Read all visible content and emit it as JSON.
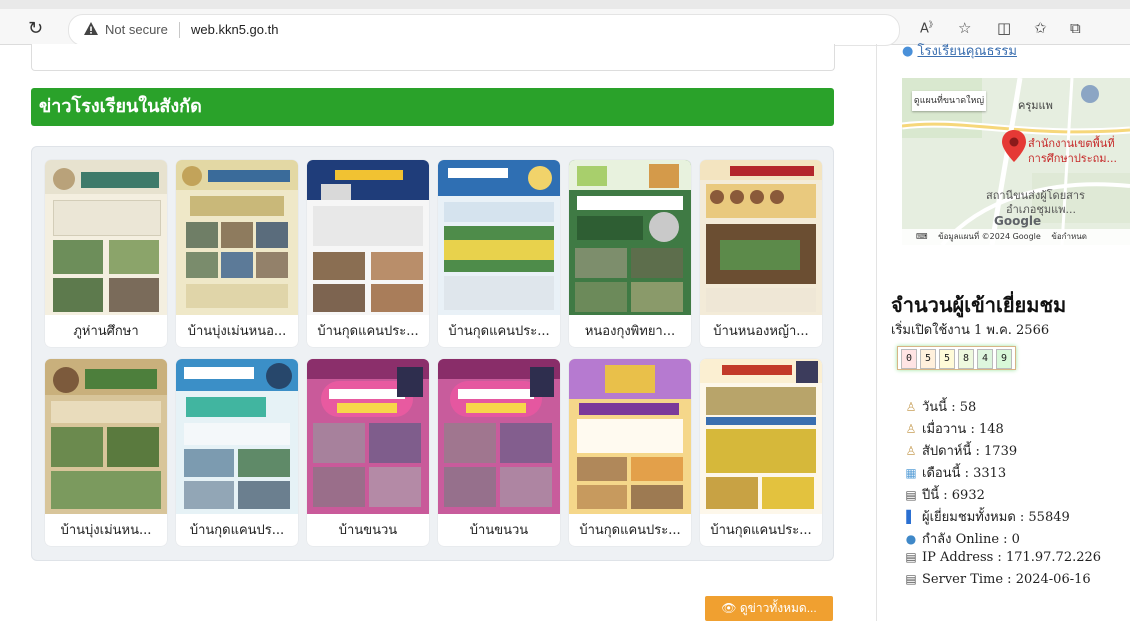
{
  "browser": {
    "reload_icon": "reload-icon",
    "security_label": "Not secure",
    "url": "web.kkn5.go.th",
    "toolbar_icons": [
      "read-aloud-icon",
      "favorite-star-icon",
      "split-screen-icon",
      "favorites-icon",
      "collections-icon"
    ]
  },
  "main": {
    "section_title": "ข่าวโรงเรียนในสังกัด",
    "news": [
      {
        "title": "ภูห่านศึกษา"
      },
      {
        "title": "บ้านบุ่งเม่นหนอ..."
      },
      {
        "title": "บ้านกุดแคนประ..."
      },
      {
        "title": "บ้านกุดแคนประ..."
      },
      {
        "title": "หนองกุงพิทยา..."
      },
      {
        "title": "บ้านหนองหญ้า..."
      },
      {
        "title": "บ้านบุ่งเม่นหน..."
      },
      {
        "title": "บ้านกุดแคนปร..."
      },
      {
        "title": "บ้านขนวน"
      },
      {
        "title": "บ้านขนวน"
      },
      {
        "title": "บ้านกุดแคนประ..."
      },
      {
        "title": "บ้านกุดแคนประ..."
      }
    ],
    "all_news_button": "👁 ดูข่าวทั้งหมด..."
  },
  "sidebar": {
    "top_link": "โรงเรียนคุณธรรม",
    "map": {
      "view_larger": "ดูแผนที่ขนาดใหญ่",
      "label_top": "ครุมแพ",
      "label_office_1": "สำนักงานเขตพื้นที่",
      "label_office_2": "การศึกษาประถม...",
      "label_station_1": "สถานีขนส่งผู้โดยสาร",
      "label_station_2": "อำเภอชุมแพ...",
      "google": "Google",
      "footer_data": "ข้อมูลแผนที่ ©2024 Google",
      "footer_terms": "ข้อกำหนด"
    },
    "stats_title": "จำนวนผู้เข้าเยี่ยมชม",
    "stats_since": "เริ่มเปิดใช้งาน 1 พ.ค. 2566",
    "counter_digits": [
      "0",
      "5",
      "5",
      "8",
      "4",
      "9"
    ],
    "counter_colors": [
      "#ffe4e4",
      "#fff0dc",
      "#fffbd8",
      "#eef9de",
      "#ddf6dd",
      "#d8f8d8"
    ],
    "stats": [
      {
        "icon": "person-icon",
        "text": "วันนี้ : 58"
      },
      {
        "icon": "person-icon",
        "text": "เมื่อวาน : 148"
      },
      {
        "icon": "person-icon",
        "text": "สัปดาห์นี้ : 1739"
      },
      {
        "icon": "calendar-month-icon",
        "text": "เดือนนี้ : 3313"
      },
      {
        "icon": "calendar-year-icon",
        "text": "ปีนี้ : 6932"
      },
      {
        "icon": "bar-chart-icon",
        "text": "ผู้เยี่ยมชมทั้งหมด : 55849"
      },
      {
        "icon": "globe-icon",
        "text": "กำลัง Online : 0"
      },
      {
        "icon": "calendar-icon",
        "text": "IP Address : 171.97.72.226"
      },
      {
        "icon": "calendar-icon",
        "text": "Server Time : 2024-06-16"
      }
    ]
  }
}
